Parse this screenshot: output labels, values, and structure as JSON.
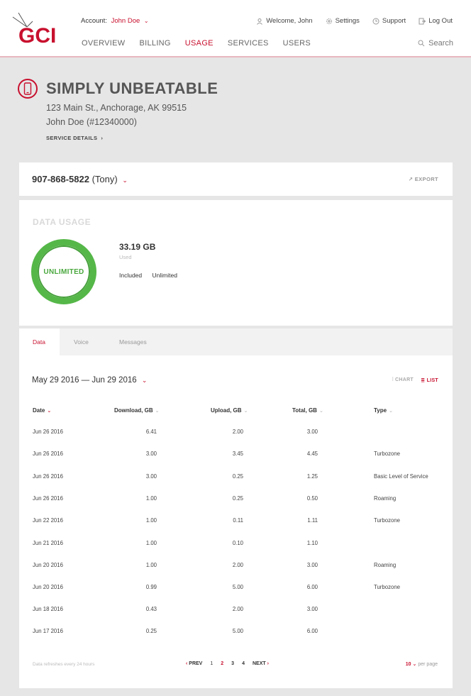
{
  "header": {
    "logo_text": "GCI",
    "account_label": "Account:",
    "account_name": "John Doe",
    "welcome": "Welcome, John",
    "settings": "Settings",
    "support": "Support",
    "logout": "Log Out",
    "search": "Search",
    "nav": [
      "OVERVIEW",
      "BILLING",
      "USAGE",
      "SERVICES",
      "USERS"
    ],
    "active_nav": "USAGE"
  },
  "plan": {
    "title": "SIMPLY UNBEATABLE",
    "address": "123 Main St., Anchorage, AK 99515",
    "owner": "John Doe (#12340000)",
    "service_details": "SERVICE DETAILS"
  },
  "line": {
    "number": "907-868-5822",
    "name": "(Tony)",
    "export": "EXPORT"
  },
  "usage": {
    "title": "DATA USAGE",
    "ring_label": "UNLIMITED",
    "used_value": "33.19 GB",
    "used_label": "Used",
    "included_label": "Included",
    "included_value": "Unlimited"
  },
  "tabs": [
    "Data",
    "Voice",
    "Messages"
  ],
  "table": {
    "range": "May 29 2016 — Jun 29 2016",
    "view_chart": "CHART",
    "view_list": "LIST",
    "columns": [
      "Date",
      "Download, GB",
      "Upload, GB",
      "Total, GB",
      "Type"
    ],
    "rows": [
      [
        "Jun 26 2016",
        "6.41",
        "2.00",
        "3.00",
        ""
      ],
      [
        "Jun 26 2016",
        "3.00",
        "3.45",
        "4.45",
        "Turbozone"
      ],
      [
        "Jun 26 2016",
        "3.00",
        "0.25",
        "1.25",
        "Basic Level of Service"
      ],
      [
        "Jun 26 2016",
        "1.00",
        "0.25",
        "0.50",
        "Roaming"
      ],
      [
        "Jun 22 2016",
        "1.00",
        "0.11",
        "1.11",
        "Turbozone"
      ],
      [
        "Jun 21 2016",
        "1.00",
        "0.10",
        "1.10",
        ""
      ],
      [
        "Jun 20 2016",
        "1.00",
        "2.00",
        "3.00",
        "Roaming"
      ],
      [
        "Jun 20 2016",
        "0.99",
        "5.00",
        "6.00",
        "Turbozone"
      ],
      [
        "Jun 18 2016",
        "0.43",
        "2.00",
        "3.00",
        ""
      ],
      [
        "Jun 17 2016",
        "0.25",
        "5.00",
        "6.00",
        ""
      ]
    ],
    "footer_note": "Data refreshes every 24 hours",
    "prev": "PREV",
    "pages": [
      "1",
      "2",
      "3",
      "4"
    ],
    "current_page": "2",
    "next": "NEXT",
    "per_page_value": "10",
    "per_page_label": "per page"
  },
  "colors": {
    "accent": "#c8102e",
    "ring": "#55b748"
  }
}
